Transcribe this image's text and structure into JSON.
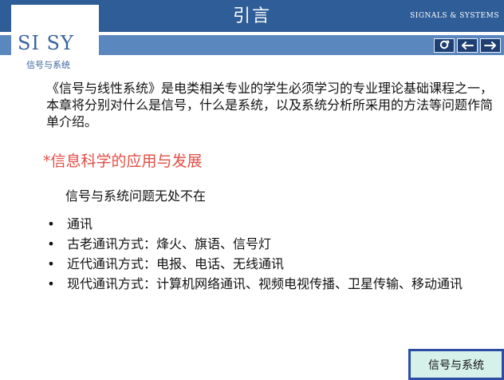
{
  "header": {
    "title": "引言",
    "brand_right": "SIGNALS & SYSTEMS"
  },
  "logo": {
    "text": "SI SY",
    "subtitle": "信号与系统"
  },
  "nav": {
    "buttons": [
      {
        "name": "refresh-button",
        "icon": "refresh-icon"
      },
      {
        "name": "back-button",
        "icon": "arrow-left-icon"
      },
      {
        "name": "forward-button",
        "icon": "arrow-right-icon"
      }
    ]
  },
  "content": {
    "intro": "《信号与线性系统》是电类相关专业的学生必须学习的专业理论基础课程之一，本章将分别对什么是信号，什么是系统，以及系统分析所采用的方法等问题作简单介绍。",
    "section_heading": "*信息科学的应用与发展",
    "subtext": "信号与系统问题无处不在",
    "bullets": [
      "通讯",
      "古老通讯方式：烽火、旗语、信号灯",
      "近代通讯方式：电报、电话、无线通讯",
      "现代通讯方式：计算机网络通讯、视频电视传播、卫星传输、移动通讯"
    ],
    "bullet_symbol": "•"
  },
  "footer": {
    "label": "信号与系统"
  },
  "colors": {
    "header_dark": "#2f5d97",
    "header_light": "#5b87bf",
    "heading_red": "#e34e45",
    "footer_bg": "#d6f1ea",
    "footer_border": "#2c4da3"
  }
}
